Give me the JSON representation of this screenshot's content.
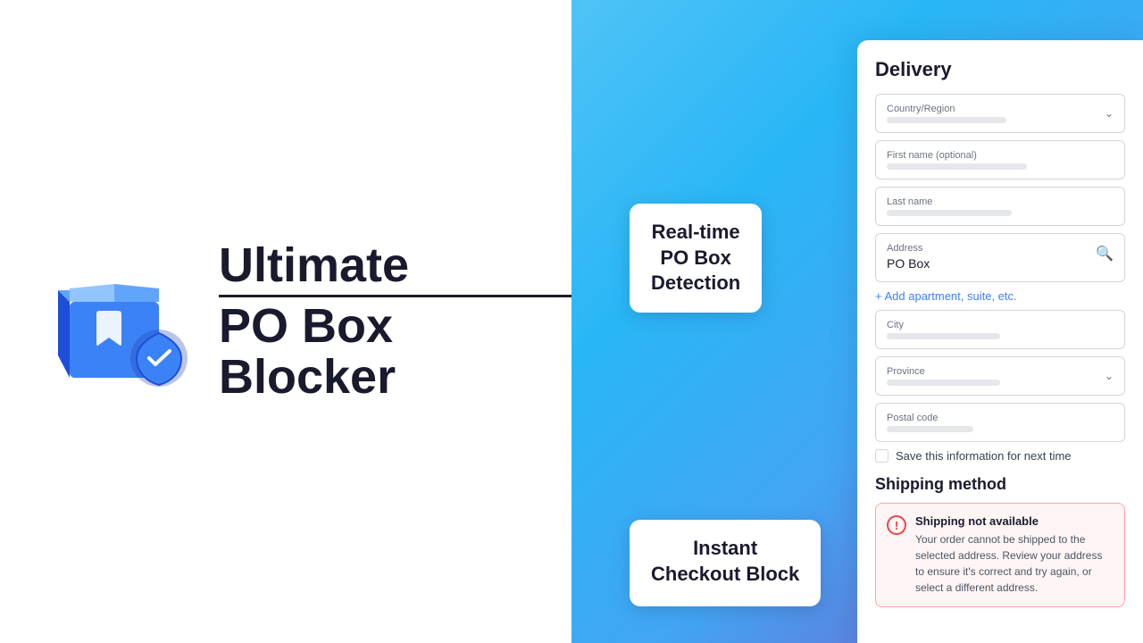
{
  "left": {
    "logo_title": "Ultimate",
    "logo_subtitle": "PO Box Blocker"
  },
  "floating": {
    "realtime_line1": "Real-time",
    "realtime_line2": "PO Box",
    "realtime_line3": "Detection",
    "instant_line1": "Instant",
    "instant_line2": "Checkout Block"
  },
  "checkout": {
    "title": "Delivery",
    "country_label": "Country/Region",
    "firstname_label": "First name (optional)",
    "lastname_label": "Last name",
    "address_label": "Address",
    "address_value": "PO Box",
    "add_apartment": "+ Add apartment, suite, etc.",
    "city_label": "City",
    "province_label": "Province",
    "postal_label": "Postal code",
    "save_label": "Save this information for next time",
    "shipping_title": "Shipping method",
    "error_title": "Shipping not available",
    "error_description": "Your order cannot be shipped to the selected address. Review your address to ensure it's correct and try again, or select a different address."
  }
}
